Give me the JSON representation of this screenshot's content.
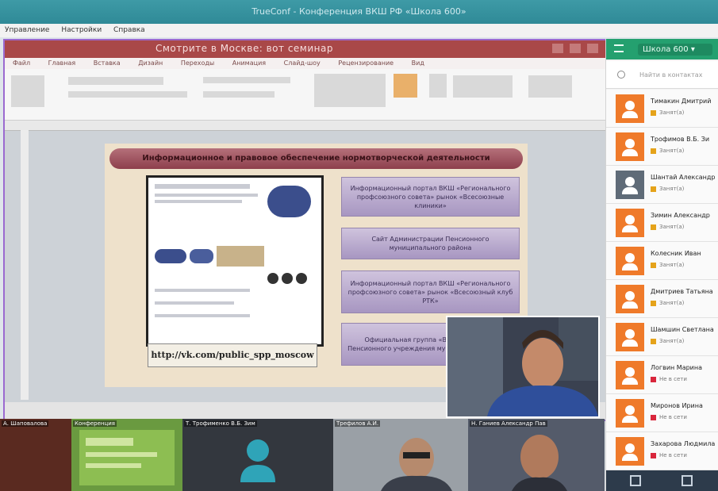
{
  "window": {
    "title": "TrueConf - Конференция ВКШ РФ «Школа 600»"
  },
  "menu": [
    "Управление",
    "Настройки",
    "Справка"
  ],
  "presentation": {
    "doc_title": "Смотрите в Москве: вот семинар",
    "ribbon_tabs": [
      "Файл",
      "Главная",
      "Вставка",
      "Дизайн",
      "Переходы",
      "Анимация",
      "Слайд-шоу",
      "Рецензирование",
      "Вид"
    ],
    "slide": {
      "banner": "Информационное и правовое обеспечение нормотворческой деятельности",
      "url_text": "http://vk.com/public_spp_moscow",
      "boxes": [
        "Информационный портал ВКШ «Регионального профсоюзного совета» рынок «Всесоюзные клиники»",
        "Сайт Администрации Пенсионного муниципального района",
        "Информационный портал ВКШ «Регионального профсоюзного совета» рынок «Всесоюзный клуб РТК»",
        "Официальная группа «ВКонтакте» ВТУ Пенсионного учреждения муниципалитет «ВСЦ»"
      ]
    }
  },
  "video_tiles": [
    {
      "label": "А. Шаповалова"
    },
    {
      "label": "Конференция"
    },
    {
      "label": "Т. Трофименко В.Б. Зим"
    },
    {
      "label": "Трефилов А.И."
    },
    {
      "label": "Н. Ганиев Александр Пав"
    }
  ],
  "sidebar": {
    "group": "Школа 600",
    "search_placeholder": "Найти в контактах",
    "participants": [
      {
        "name": "Тимакин Дмитрий",
        "status": "Занят(а)",
        "color": "#e5a31a"
      },
      {
        "name": "Трофимов В.Б. Зи",
        "status": "Занят(а)",
        "color": "#e5a31a"
      },
      {
        "name": "Шантай Александр",
        "status": "Занят(а)",
        "color": "#e5a31a"
      },
      {
        "name": "Зимин Александр",
        "status": "Занят(а)",
        "color": "#e5a31a"
      },
      {
        "name": "Колесник Иван",
        "status": "Занят(а)",
        "color": "#e5a31a"
      },
      {
        "name": "Дмитриев Татьяна",
        "status": "Занят(а)",
        "color": "#e5a31a"
      },
      {
        "name": "Шамшин Светлана",
        "status": "Занят(а)",
        "color": "#e5a31a"
      },
      {
        "name": "Логвин Марина",
        "status": "Не в сети",
        "color": "#d9263c"
      },
      {
        "name": "Миронов Ирина",
        "status": "Не в сети",
        "color": "#d9263c"
      },
      {
        "name": "Захарова Людмила",
        "status": "Не в сети",
        "color": "#d9263c"
      }
    ]
  }
}
